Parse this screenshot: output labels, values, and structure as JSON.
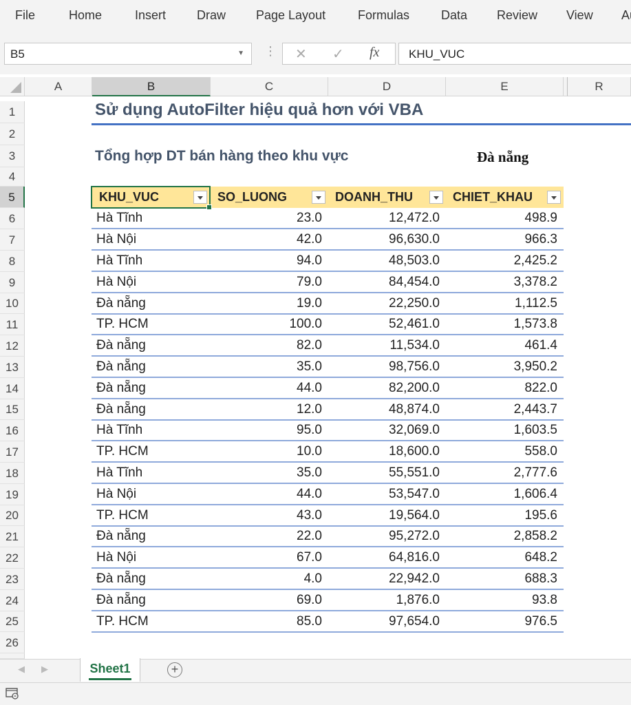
{
  "ribbon": {
    "tabs": [
      "File",
      "Home",
      "Insert",
      "Draw",
      "Page Layout",
      "Formulas",
      "Data",
      "Review",
      "View",
      "Au"
    ]
  },
  "formula_bar": {
    "name_box": "B5",
    "fx_label": "fx",
    "content": "KHU_VUC"
  },
  "columns": [
    "A",
    "B",
    "C",
    "D",
    "E",
    "R"
  ],
  "rows": [
    "1",
    "2",
    "3",
    "4",
    "5",
    "6",
    "7",
    "8",
    "9",
    "10",
    "11",
    "12",
    "13",
    "14",
    "15",
    "16",
    "17",
    "18",
    "19",
    "20",
    "21",
    "22",
    "23",
    "24",
    "25",
    "26"
  ],
  "sheet": {
    "title": "Sử dụng AutoFilter hiệu quả hơn với VBA",
    "subtitle": "Tổng hợp DT bán hàng theo khu vực",
    "criteria": "Đà nẵng",
    "table": {
      "headers": [
        "KHU_VUC",
        "SO_LUONG",
        "DOANH_THU",
        "CHIET_KHAU"
      ],
      "rows": [
        [
          "Hà Tĩnh",
          "23.0",
          "12,472.0",
          "498.9"
        ],
        [
          "Hà Nội",
          "42.0",
          "96,630.0",
          "966.3"
        ],
        [
          "Hà Tĩnh",
          "94.0",
          "48,503.0",
          "2,425.2"
        ],
        [
          "Hà Nội",
          "79.0",
          "84,454.0",
          "3,378.2"
        ],
        [
          "Đà nẵng",
          "19.0",
          "22,250.0",
          "1,112.5"
        ],
        [
          "TP. HCM",
          "100.0",
          "52,461.0",
          "1,573.8"
        ],
        [
          "Đà nẵng",
          "82.0",
          "11,534.0",
          "461.4"
        ],
        [
          "Đà nẵng",
          "35.0",
          "98,756.0",
          "3,950.2"
        ],
        [
          "Đà nẵng",
          "44.0",
          "82,200.0",
          "822.0"
        ],
        [
          "Đà nẵng",
          "12.0",
          "48,874.0",
          "2,443.7"
        ],
        [
          "Hà Tĩnh",
          "95.0",
          "32,069.0",
          "1,603.5"
        ],
        [
          "TP. HCM",
          "10.0",
          "18,600.0",
          "558.0"
        ],
        [
          "Hà Tĩnh",
          "35.0",
          "55,551.0",
          "2,777.6"
        ],
        [
          "Hà Nội",
          "44.0",
          "53,547.0",
          "1,606.4"
        ],
        [
          "TP. HCM",
          "43.0",
          "19,564.0",
          "195.6"
        ],
        [
          "Đà nẵng",
          "22.0",
          "95,272.0",
          "2,858.2"
        ],
        [
          "Hà Nội",
          "67.0",
          "64,816.0",
          "648.2"
        ],
        [
          "Đà nẵng",
          "4.0",
          "22,942.0",
          "688.3"
        ],
        [
          "Đà nẵng",
          "69.0",
          "1,876.0",
          "93.8"
        ],
        [
          "TP. HCM",
          "85.0",
          "97,654.0",
          "976.5"
        ]
      ]
    }
  },
  "sheet_tabs": {
    "active": "Sheet1",
    "add_label": "+"
  },
  "colors": {
    "accent": "#217346",
    "header_fill": "#ffe699",
    "title_color": "#44546a",
    "rule_color": "#4472c4",
    "row_line": "#8ea9db"
  }
}
